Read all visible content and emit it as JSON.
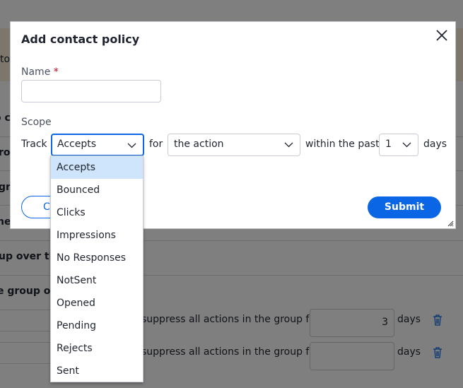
{
  "background": {
    "fragments": [
      "to",
      "o c",
      "ro",
      "gr",
      "ne",
      "up over th",
      "e group ove"
    ],
    "rows": [
      {
        "text": "suppress all actions in the group for",
        "value": "3",
        "unit": "days"
      },
      {
        "text": "suppress all actions in the group for",
        "value": "",
        "unit": "days"
      }
    ]
  },
  "modal": {
    "title": "Add contact policy",
    "name_label": "Name",
    "required_mark": "*",
    "name_value": "",
    "scope_label": "Scope",
    "track_label": "Track",
    "track_value": "Accepts",
    "for_label": "for",
    "for_value": "the action",
    "within_label": "within the past",
    "days_value": "1",
    "days_label": "days",
    "cancel_label": "Cancel",
    "submit_label": "Submit"
  },
  "dropdown": {
    "selected": "Accepts",
    "options": [
      "Accepts",
      "Bounced",
      "Clicks",
      "Impressions",
      "No Responses",
      "NotSent",
      "Opened",
      "Pending",
      "Rejects",
      "Sent"
    ]
  },
  "colors": {
    "accent": "#0a66e4",
    "selected_option": "#cfe5fb",
    "required": "#d0021b"
  }
}
